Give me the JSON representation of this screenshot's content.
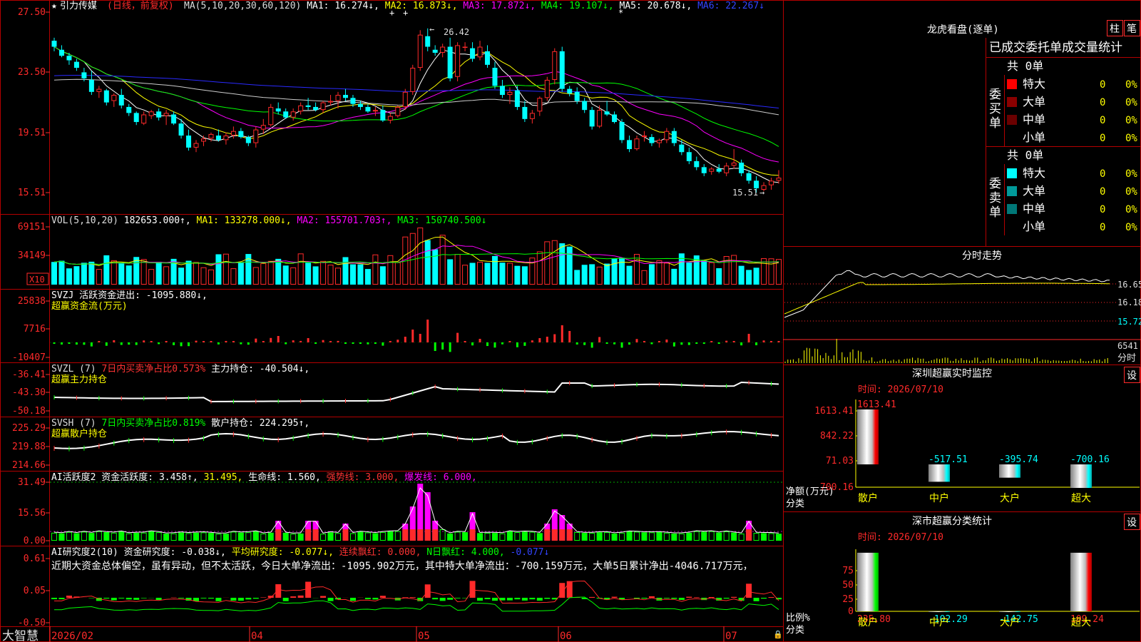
{
  "app": {
    "brand": "大智慧",
    "title_star": "★",
    "stock_name": "引力传媒",
    "period": "(日线，前复权)"
  },
  "colors": {
    "bg": "#000000",
    "frame": "#b40000",
    "up": "#ff2a2a",
    "down": "#00ffff",
    "yellow": "#ffff00",
    "magenta": "#ff00ff",
    "green": "#00dd00",
    "white": "#ffffff",
    "label": "#e0e0e0",
    "blue": "#1a1aff",
    "grey": "#c8c8c8"
  },
  "main_panel": {
    "ma_segments": [
      {
        "text": "MA(5,10,20,30,60,120)",
        "color": "#dddddd"
      },
      {
        "text": " MA1: 16.274↓,",
        "color": "#ffffff"
      },
      {
        "text": " MA2: 16.873↓,",
        "color": "#ffff00"
      },
      {
        "text": " MA3: 17.872↓,",
        "color": "#ff00ff"
      },
      {
        "text": " MA4: 19.107↓,",
        "color": "#00ff00"
      },
      {
        "text": " MA5: 20.678↓,",
        "color": "#ffffff"
      },
      {
        "text": " MA6: 22.267↓",
        "color": "#3344ff"
      }
    ],
    "y_labels": [
      "27.50",
      "23.50",
      "19.51",
      "15.51"
    ],
    "high_label": "26.42",
    "low_label": "15.51"
  },
  "vol_panel": {
    "segments": [
      {
        "text": "VOL(5,10,20) ",
        "color": "#dddddd"
      },
      {
        "text": "182653.000↑,",
        "color": "#ffffff"
      },
      {
        "text": " MA1: 133278.000↓,",
        "color": "#ffff00"
      },
      {
        "text": " MA2: 155701.703↑,",
        "color": "#ff00ff"
      },
      {
        "text": " MA3: 150740.500↓",
        "color": "#00ff00"
      }
    ],
    "y_labels": [
      "69151",
      "34149"
    ],
    "unit": "X10"
  },
  "svzj_panel": {
    "segments": [
      {
        "text": "SVZJ  活跃资金进出: -1095.880↓,",
        "color": "#ffffff"
      }
    ],
    "subtitle": "超赢资金流(万元)",
    "y_labels": [
      "25838",
      "7716",
      "-10407"
    ]
  },
  "svzl_panel": {
    "segments": [
      {
        "text": "SVZL (7) ",
        "color": "#dddddd"
      },
      {
        "text": "7日内买卖净占比0.573%",
        "color": "#ff3333"
      },
      {
        "text": " 主力持仓: -40.504↓,",
        "color": "#ffffff"
      }
    ],
    "subtitle": "超赢主力持仓",
    "y_labels": [
      "-36.41",
      "-43.30",
      "-50.18"
    ]
  },
  "svsh_panel": {
    "segments": [
      {
        "text": "SVSH (7) ",
        "color": "#dddddd"
      },
      {
        "text": "7日内买卖净占比0.819%",
        "color": "#00ff00"
      },
      {
        "text": " 散户持仓: 224.295↑,",
        "color": "#ffffff"
      }
    ],
    "subtitle": "超赢散户持仓",
    "y_labels": [
      "225.29",
      "219.88",
      "214.66"
    ]
  },
  "ai_active_panel": {
    "segments": [
      {
        "text": "AI活跃度2 资金活跃度: 3.458↑,",
        "color": "#ffffff"
      },
      {
        "text": " 31.495,",
        "color": "#ffff00"
      },
      {
        "text": " 生命线: 1.560,",
        "color": "#ffffff"
      },
      {
        "text": " 强势线: 3.000,",
        "color": "#ff3333"
      },
      {
        "text": " 爆发线: 6.000,",
        "color": "#ff00ff"
      }
    ],
    "y_labels": [
      "31.49",
      "15.56",
      "0.00"
    ]
  },
  "ai_research_panel": {
    "segments": [
      {
        "text": "AI研究度2(10) 资金研究度: -0.038↓,",
        "color": "#ffffff"
      },
      {
        "text": " 平均研究度: -0.077↓,",
        "color": "#ffff00"
      },
      {
        "text": " 连续飘红: 0.000,",
        "color": "#ff3333"
      },
      {
        "text": " N日飘红: 4.000,",
        "color": "#00ff00"
      },
      {
        "text": " -0.077↓",
        "color": "#3344ff"
      }
    ],
    "comment": "近期大资金总体偏空，虽有异动，但不太活跃，今日大单净流出：-1095.902万元，其中特大单净流出：-700.159万元，大单5日累计净出-4046.717万元，",
    "y_labels": [
      "0.61",
      "0.05",
      "-0.50"
    ]
  },
  "x_axis": {
    "labels": [
      "2026/02",
      "04",
      "05",
      "06",
      "07"
    ]
  },
  "dragon_tiger": {
    "title": "龙虎看盘(逐单)",
    "btn_bar": "柱",
    "btn_tick": "笔",
    "header": "已成交委托单成交量统计",
    "buy": {
      "side_label": "委买单",
      "total": "共 0单",
      "rows": [
        {
          "label": "特大",
          "count": "0",
          "pct": "0%",
          "color": "#ff0000"
        },
        {
          "label": "大单",
          "count": "0",
          "pct": "0%",
          "color": "#8b0000"
        },
        {
          "label": "中单",
          "count": "0",
          "pct": "0%",
          "color": "#6a0000"
        },
        {
          "label": "小单",
          "count": "0",
          "pct": "0%",
          "color": "#000000"
        }
      ]
    },
    "sell": {
      "side_label": "委卖单",
      "total": "共 0单",
      "rows": [
        {
          "label": "特大",
          "count": "0",
          "pct": "0%",
          "color": "#00ffff"
        },
        {
          "label": "大单",
          "count": "0",
          "pct": "0%",
          "color": "#009999"
        },
        {
          "label": "中单",
          "count": "0",
          "pct": "0%",
          "color": "#007777"
        },
        {
          "label": "小单",
          "count": "0",
          "pct": "0%",
          "color": "#000000"
        }
      ]
    }
  },
  "intraday": {
    "title": "分时走势",
    "y_labels": [
      "16.65",
      "16.18",
      "15.72"
    ],
    "vol_label": "6541",
    "corner_label": "分时"
  },
  "sz_monitor": {
    "title": "深圳超赢实时监控",
    "settings_btn": "设",
    "time": "时间: 2026/07/10",
    "y_labels": [
      "1613.41",
      "842.22",
      "71.03",
      "-700.16"
    ],
    "bars": [
      {
        "category": "散户",
        "value": 1613.41,
        "label": "1613.41"
      },
      {
        "category": "中户",
        "value": -517.51,
        "label": "-517.51"
      },
      {
        "category": "大户",
        "value": -395.74,
        "label": "-395.74"
      },
      {
        "category": "超大",
        "value": -700.16,
        "label": "-700.16"
      }
    ],
    "axis_title": "净额(万元)",
    "axis_cat": "分类"
  },
  "sz_stats": {
    "title": "深市超赢分类统计",
    "settings_btn": "设",
    "time": "时间: 2026/07/10",
    "y_labels": [
      "75",
      "50",
      "25",
      "0"
    ],
    "bars": [
      {
        "category": "散户",
        "value": 235.8,
        "label": "235.80"
      },
      {
        "category": "中户",
        "value": -102.29,
        "label": "-102.29"
      },
      {
        "category": "大户",
        "value": -142.75,
        "label": "-142.75"
      },
      {
        "category": "超大",
        "value": 109.24,
        "label": "109.24"
      }
    ],
    "axis_title": "比例%",
    "axis_cat": "分类"
  },
  "chart_data": [
    {
      "type": "candlestick",
      "title": "引力传媒 (日线，前复权)",
      "x_range": [
        "2026/02",
        "2026/07/10"
      ],
      "ylim": [
        15.51,
        27.5
      ],
      "ohlc": [
        [
          25.6,
          25.8,
          24.9,
          25.2
        ],
        [
          25.0,
          25.3,
          24.5,
          24.6
        ],
        [
          24.6,
          24.8,
          24.0,
          24.3
        ],
        [
          24.2,
          24.4,
          23.6,
          23.8
        ],
        [
          23.5,
          23.8,
          22.9,
          23.1
        ],
        [
          23.0,
          23.6,
          22.0,
          22.2
        ],
        [
          22.2,
          22.6,
          21.8,
          22.4
        ],
        [
          22.3,
          22.4,
          21.3,
          21.5
        ],
        [
          21.6,
          22.1,
          21.2,
          22.0
        ],
        [
          22.0,
          22.4,
          21.1,
          21.3
        ],
        [
          21.2,
          21.4,
          20.6,
          20.8
        ],
        [
          20.8,
          20.9,
          20.0,
          20.2
        ],
        [
          20.1,
          20.9,
          20.0,
          20.7
        ],
        [
          20.6,
          21.0,
          20.4,
          20.9
        ],
        [
          20.9,
          21.1,
          20.3,
          20.5
        ],
        [
          20.6,
          21.0,
          20.0,
          20.8
        ],
        [
          20.7,
          20.9,
          20.0,
          20.1
        ],
        [
          20.1,
          20.4,
          19.1,
          19.3
        ],
        [
          19.3,
          19.7,
          18.3,
          18.5
        ],
        [
          18.5,
          19.0,
          18.2,
          18.8
        ],
        [
          18.9,
          19.3,
          18.6,
          19.1
        ],
        [
          19.1,
          19.5,
          18.9,
          19.4
        ],
        [
          19.3,
          19.7,
          18.9,
          19.0
        ],
        [
          19.0,
          19.5,
          18.7,
          19.3
        ],
        [
          19.3,
          19.9,
          19.1,
          19.6
        ],
        [
          19.6,
          19.8,
          19.1,
          19.2
        ],
        [
          19.2,
          19.3,
          18.6,
          18.8
        ],
        [
          18.8,
          19.9,
          18.5,
          19.7
        ],
        [
          19.7,
          20.4,
          19.4,
          20.0
        ],
        [
          20.0,
          21.4,
          19.9,
          21.2
        ],
        [
          21.1,
          21.5,
          20.7,
          20.9
        ],
        [
          20.9,
          21.1,
          20.4,
          20.5
        ],
        [
          20.5,
          21.1,
          20.3,
          20.9
        ],
        [
          20.9,
          21.5,
          20.7,
          21.3
        ],
        [
          21.3,
          21.8,
          21.0,
          21.2
        ],
        [
          21.2,
          21.5,
          20.9,
          21.0
        ],
        [
          21.0,
          21.6,
          20.8,
          21.5
        ],
        [
          21.5,
          22.0,
          21.3,
          21.6
        ],
        [
          21.6,
          22.2,
          21.1,
          22.0
        ],
        [
          22.0,
          22.4,
          21.6,
          21.8
        ],
        [
          21.8,
          22.0,
          21.2,
          21.4
        ],
        [
          21.4,
          21.6,
          21.0,
          21.2
        ],
        [
          21.2,
          21.4,
          20.8,
          20.9
        ],
        [
          20.9,
          21.2,
          20.6,
          21.0
        ],
        [
          21.0,
          21.3,
          20.2,
          20.3
        ],
        [
          20.3,
          20.8,
          20.1,
          20.6
        ],
        [
          20.6,
          21.3,
          20.5,
          21.2
        ],
        [
          21.2,
          22.4,
          21.0,
          22.2
        ],
        [
          22.2,
          24.0,
          22.0,
          23.8
        ],
        [
          23.8,
          26.3,
          23.6,
          26.0
        ],
        [
          25.9,
          26.42,
          24.9,
          25.2
        ],
        [
          25.0,
          25.3,
          24.6,
          24.8
        ],
        [
          24.8,
          25.4,
          24.5,
          25.2
        ],
        [
          25.2,
          25.8,
          22.9,
          23.1
        ],
        [
          23.2,
          25.5,
          22.9,
          25.3
        ],
        [
          25.2,
          25.5,
          24.9,
          25.2
        ],
        [
          25.1,
          25.5,
          24.2,
          24.4
        ],
        [
          24.5,
          25.6,
          24.3,
          25.2
        ],
        [
          24.9,
          25.3,
          23.8,
          24.0
        ],
        [
          23.8,
          24.2,
          22.4,
          22.6
        ],
        [
          22.6,
          23.0,
          21.8,
          22.0
        ],
        [
          22.0,
          22.5,
          21.4,
          22.2
        ],
        [
          22.3,
          22.6,
          21.0,
          21.2
        ],
        [
          21.2,
          21.6,
          20.2,
          20.4
        ],
        [
          20.4,
          21.0,
          20.1,
          20.8
        ],
        [
          20.9,
          21.9,
          20.6,
          21.8
        ],
        [
          21.8,
          23.2,
          21.6,
          23.0
        ],
        [
          23.0,
          25.1,
          22.7,
          24.9
        ],
        [
          24.9,
          25.2,
          22.2,
          22.4
        ],
        [
          22.4,
          22.6,
          21.9,
          22.1
        ],
        [
          22.2,
          22.5,
          21.4,
          21.6
        ],
        [
          21.6,
          21.8,
          20.8,
          21.0
        ],
        [
          21.0,
          21.2,
          19.7,
          19.9
        ],
        [
          19.9,
          21.3,
          19.8,
          21.0
        ],
        [
          20.9,
          21.6,
          20.6,
          20.7
        ],
        [
          20.7,
          20.9,
          20.1,
          20.2
        ],
        [
          20.2,
          20.4,
          18.8,
          19.0
        ],
        [
          19.0,
          19.3,
          18.2,
          18.4
        ],
        [
          18.4,
          19.3,
          18.3,
          19.1
        ],
        [
          19.2,
          19.6,
          18.9,
          19.3
        ],
        [
          19.2,
          19.4,
          18.6,
          18.8
        ],
        [
          18.8,
          19.1,
          18.5,
          19.0
        ],
        [
          19.0,
          19.8,
          18.8,
          19.6
        ],
        [
          19.6,
          19.8,
          18.6,
          18.8
        ],
        [
          18.7,
          19.0,
          18.0,
          18.2
        ],
        [
          18.2,
          18.5,
          17.4,
          17.6
        ],
        [
          17.6,
          17.9,
          17.0,
          17.2
        ],
        [
          17.2,
          17.4,
          16.6,
          16.8
        ],
        [
          16.9,
          17.2,
          16.7,
          17.1
        ],
        [
          17.1,
          17.4,
          16.8,
          16.9
        ],
        [
          16.8,
          17.5,
          16.6,
          17.3
        ],
        [
          17.3,
          18.4,
          17.1,
          17.5
        ],
        [
          17.5,
          17.7,
          16.6,
          16.8
        ],
        [
          16.8,
          17.0,
          16.1,
          16.3
        ],
        [
          16.3,
          16.6,
          15.51,
          15.8
        ],
        [
          15.7,
          16.2,
          15.6,
          16.0
        ],
        [
          16.0,
          16.5,
          15.7,
          16.3
        ],
        [
          16.3,
          17.0,
          16.1,
          16.5
        ]
      ]
    },
    {
      "type": "bar",
      "title": "深圳超赢实时监控",
      "categories": [
        "散户",
        "中户",
        "大户",
        "超大"
      ],
      "values": [
        1613.41,
        -517.51,
        -395.74,
        -700.16
      ],
      "ylabel": "净额(万元)",
      "ylim": [
        -700.16,
        1613.41
      ]
    },
    {
      "type": "bar",
      "title": "深市超赢分类统计",
      "categories": [
        "散户",
        "中户",
        "大户",
        "超大"
      ],
      "values": [
        235.8,
        -102.29,
        -142.75,
        109.24
      ],
      "ylabel": "比例%",
      "ylim": [
        0,
        75
      ]
    }
  ]
}
